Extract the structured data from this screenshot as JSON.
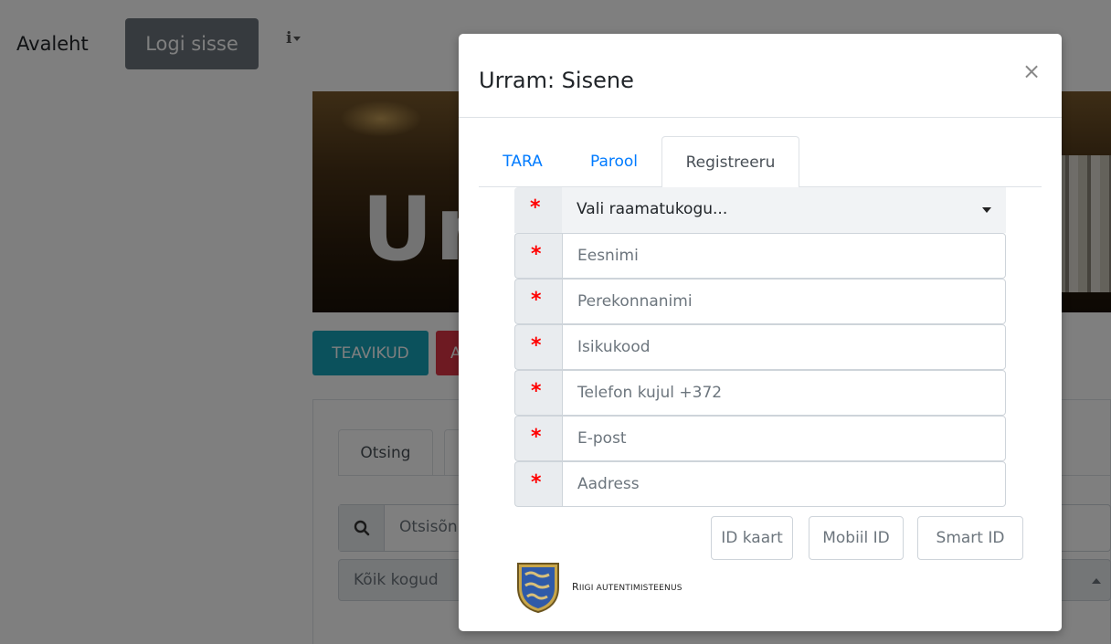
{
  "nav": {
    "home": "Avaleht",
    "login": "Logi sisse",
    "info": "i"
  },
  "hero": {
    "title_visible": "Ur"
  },
  "buttons": {
    "teavikud": "TEAVIKUD",
    "second_partial": "A"
  },
  "search": {
    "tab_otsing": "Otsing",
    "placeholder_partial": "Otsisõn",
    "collections": "Kõik kogud"
  },
  "modal": {
    "title": "Urram: Sisene",
    "close": "×",
    "tabs": [
      {
        "label": "TARA"
      },
      {
        "label": "Parool"
      },
      {
        "label": "Registreeru"
      }
    ],
    "required_marker": "*",
    "library_select": "Vali raamatukogu...",
    "fields": [
      {
        "placeholder": "Eesnimi"
      },
      {
        "placeholder": "Perekonnanimi"
      },
      {
        "placeholder": "Isikukood"
      },
      {
        "placeholder": "Telefon kujul +372"
      },
      {
        "placeholder": "E-post"
      },
      {
        "placeholder": "Aadress"
      }
    ],
    "id_buttons": {
      "id_card": "ID kaart",
      "mobile_id": "Mobiil ID",
      "smart_id": "Smart ID"
    },
    "footer": {
      "ria_first": "R",
      "ria_rest": "IIGI AUTENTIMISTEENUS"
    }
  },
  "colors": {
    "link": "#007bff",
    "required": "#ff0000",
    "teavikud": "#17a2b8",
    "danger": "#dc3545",
    "nav_button": "#6c757d"
  }
}
